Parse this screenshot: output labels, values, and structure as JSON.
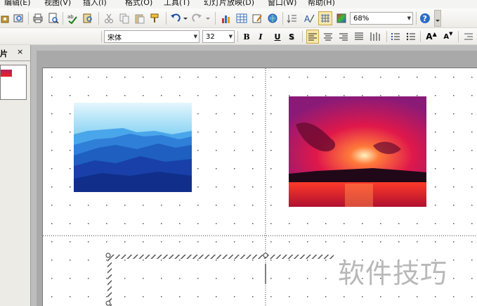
{
  "menu": [
    "编辑(E)",
    "视图(V)",
    "插入(I)",
    "格式(O)",
    "工具(T)",
    "幻灯片放映(D)",
    "窗口(W)",
    "帮助(H)"
  ],
  "toolbar": {
    "zoom_value": "68%",
    "help_glyph": "?"
  },
  "format_bar": {
    "font_name": "宋体",
    "font_size": "32",
    "bold_label": "B",
    "italic_label": "I",
    "underline_label": "U",
    "shadow_label": "S",
    "grow_font_label": "A",
    "shrink_font_label": "A"
  },
  "panel": {
    "tab_label": "片",
    "close_label": "×"
  },
  "slide": {
    "picture_1_name": "blue-mountains-picture",
    "picture_2_name": "sunset-sea-picture"
  },
  "watermark": "软件技巧",
  "colors": {
    "accent_blue": "#1e4fb8",
    "sunset_red": "#d81b2b",
    "menubar_bg": "#f4f4f2",
    "workspace_gray": "#a9a9a9"
  }
}
